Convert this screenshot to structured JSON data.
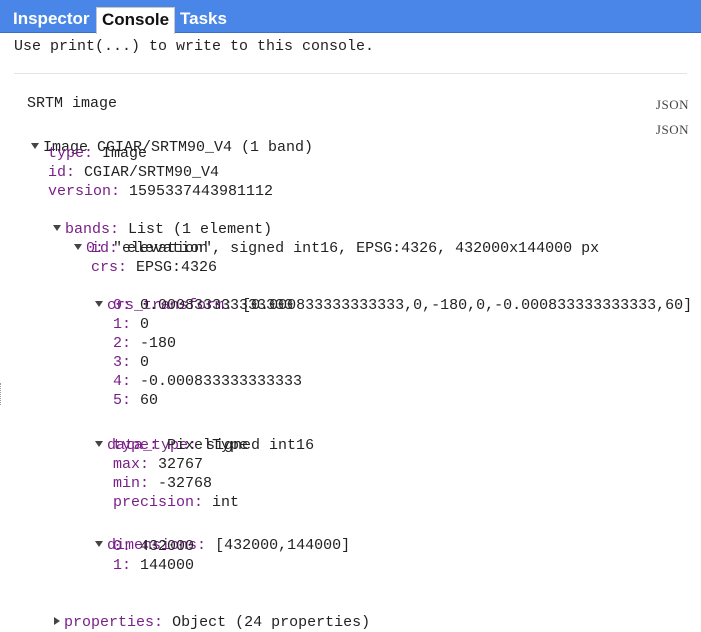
{
  "tabs": {
    "inspector": "Inspector",
    "console": "Console",
    "tasks": "Tasks"
  },
  "console_hint": "Use print(...) to write to this console.",
  "json_label": "JSON",
  "srtm_label": "SRTM image",
  "image_header": "Image CGIAR/SRTM90_V4 (1 band)",
  "image": {
    "type_key": "type:",
    "type_val": "Image",
    "id_key": "id:",
    "id_val": "CGIAR/SRTM90_V4",
    "version_key": "version:",
    "version_val": "1595337443981112"
  },
  "bands": {
    "key": "bands:",
    "val": "List (1 element)",
    "band0": {
      "key": "0:",
      "val": "\"elevation\", signed int16, EPSG:4326, 432000x144000 px",
      "id_key": "id:",
      "id_val": "elevation",
      "crs_key": "crs:",
      "crs_val": "EPSG:4326",
      "crs_transform": {
        "key": "crs_transform:",
        "val": "[0.000833333333333,0,-180,0,-0.000833333333333,60]",
        "items": [
          {
            "k": "0:",
            "v": "0.000833333333333"
          },
          {
            "k": "1:",
            "v": "0"
          },
          {
            "k": "2:",
            "v": "-180"
          },
          {
            "k": "3:",
            "v": "0"
          },
          {
            "k": "4:",
            "v": "-0.000833333333333"
          },
          {
            "k": "5:",
            "v": "60"
          }
        ]
      },
      "data_type": {
        "key": "data_type:",
        "val": "signed int16",
        "type_key": "type:",
        "type_val": "PixelType",
        "max_key": "max:",
        "max_val": "32767",
        "min_key": "min:",
        "min_val": "-32768",
        "precision_key": "precision:",
        "precision_val": "int"
      },
      "dimensions": {
        "key": "dimensions:",
        "val": "[432000,144000]",
        "items": [
          {
            "k": "0:",
            "v": "432000"
          },
          {
            "k": "1:",
            "v": "144000"
          }
        ]
      }
    }
  },
  "properties": {
    "key": "properties:",
    "val": "Object (24 properties)"
  }
}
